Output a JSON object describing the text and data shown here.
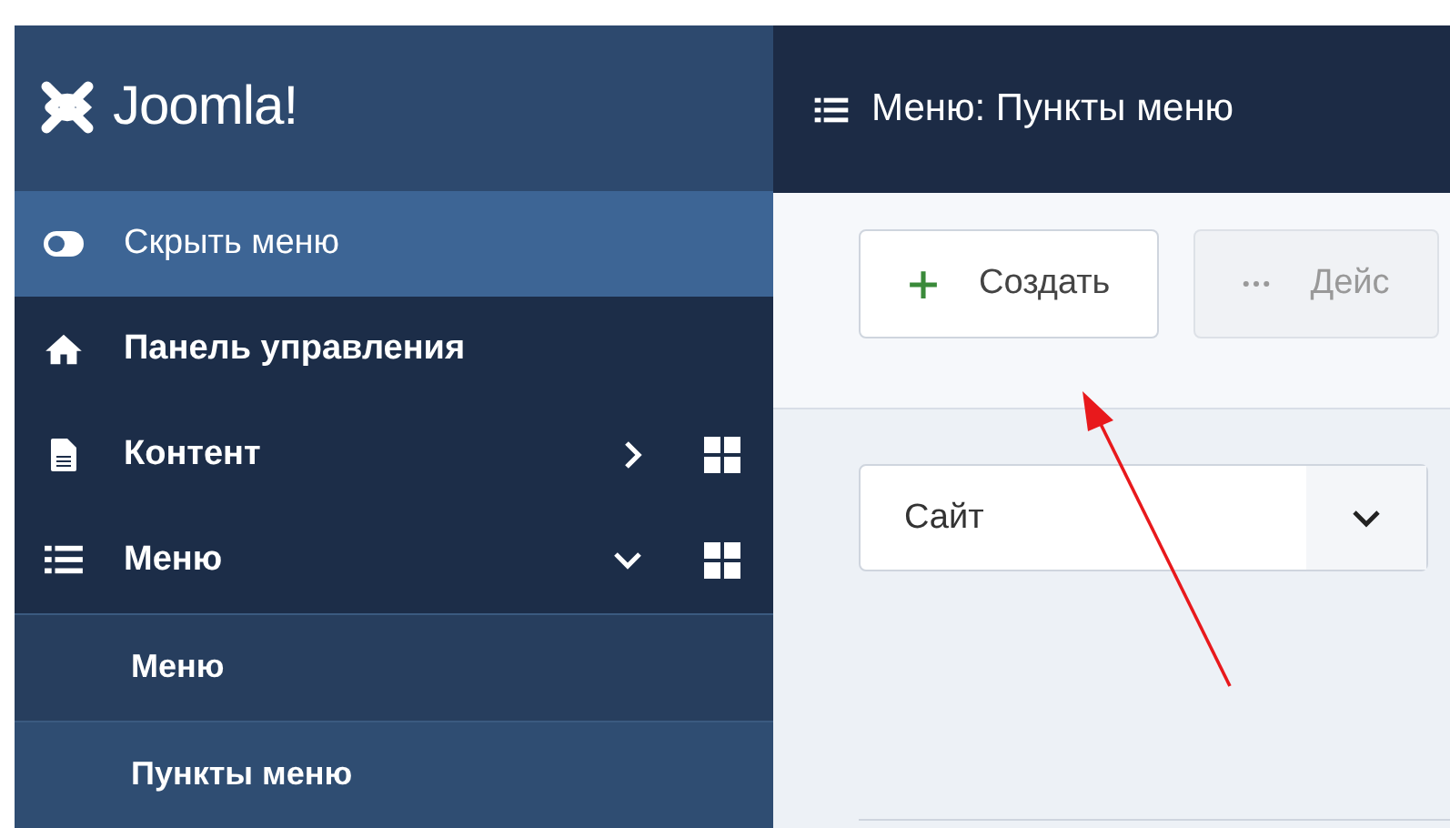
{
  "sidebar": {
    "logo": "Joomla!",
    "toggle": {
      "label": "Скрыть меню"
    },
    "items": [
      {
        "label": "Панель управления",
        "kind": "home"
      },
      {
        "label": "Контент",
        "kind": "content",
        "expanded": false
      },
      {
        "label": "Меню",
        "kind": "menu",
        "expanded": true,
        "children": [
          {
            "label": "Меню",
            "selected": false
          },
          {
            "label": "Пункты меню",
            "selected": true
          }
        ]
      }
    ]
  },
  "header": {
    "title": "Меню: Пункты меню"
  },
  "toolbar": [
    {
      "label": "Создать",
      "kind": "new",
      "disabled": false
    },
    {
      "label": "Дейс",
      "kind": "actions",
      "disabled": true
    }
  ],
  "filter": {
    "value": "Сайт"
  }
}
